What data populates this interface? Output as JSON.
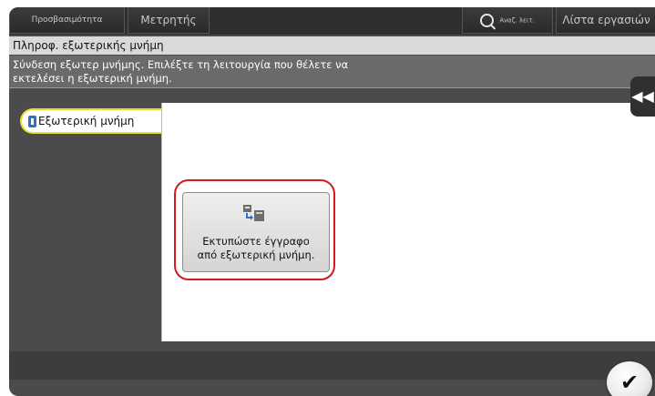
{
  "topbar": {
    "accessibility_label": "Προσβασιμότητα",
    "counter_label": "Μετρητής",
    "search_label": "Αναζ. λειτ.",
    "job_list_label": "Λίστα εργασιών",
    "icons": {
      "search": "search-icon"
    }
  },
  "header": {
    "title": "Πληροφ. εξωτερικής μνήμη",
    "message_line1": "Σύνδεση εξωτερ μνήμης. Επιλέξτε τη λειτουργία που θέλετε να",
    "message_line2": "εκτελέσει η εξωτερική μνήμη."
  },
  "sidebar": {
    "external_memory_label": "Εξωτερική μνήμη",
    "icon": "usb-drive-icon",
    "collapse_label": "◀◀"
  },
  "main": {
    "print_button": {
      "line1": "Εκτυπώστε έγγραφο",
      "line2": "από εξωτερική μνήμη.",
      "icon": "print-from-memory-icon"
    }
  },
  "footer": {
    "ok_label": "✔"
  },
  "colors": {
    "highlight": "#d6191a",
    "selected_tab_outline": "#e9e02a",
    "background": "#4b4b4b"
  }
}
